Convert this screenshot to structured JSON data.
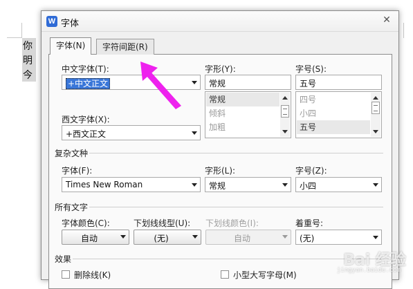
{
  "document": {
    "chars": [
      "你",
      "明",
      "今"
    ]
  },
  "dialog": {
    "app_icon": "W",
    "title": "字体",
    "close_glyph": "✕",
    "tabs": [
      {
        "label": "字体(N)",
        "active": true
      },
      {
        "label": "字符间距(R)",
        "active": false
      }
    ],
    "chinese_font": {
      "label": "中文字体(T):",
      "value": "+中文正文"
    },
    "western_font": {
      "label": "西文字体(X):",
      "value": "+西文正文"
    },
    "style": {
      "label": "字形(Y):",
      "value": "常规",
      "options": [
        "常规",
        "倾斜",
        "加粗"
      ],
      "selected": "常规"
    },
    "size": {
      "label": "字号(S):",
      "value": "五号",
      "options": [
        "四号",
        "小四",
        "五号"
      ],
      "selected": "五号"
    },
    "complex_script": {
      "title": "复杂文种",
      "font_label": "字体(F):",
      "font_value": "Times New Roman",
      "style_label": "字形(L):",
      "style_value": "常规",
      "size_label": "字号(Z):",
      "size_value": "小四"
    },
    "all_text": {
      "title": "所有文字",
      "font_color_label": "字体颜色(C):",
      "font_color_value": "自动",
      "underline_type_label": "下划线线型(U):",
      "underline_type_value": "(无)",
      "underline_color_label": "下划线颜色(I):",
      "underline_color_value": "自动",
      "emphasis_label": "着重号:",
      "emphasis_value": "(无)"
    },
    "effects": {
      "title": "效果",
      "strikethrough_label": "删除线(K)",
      "small_caps_label": "小型大写字母(M)"
    }
  },
  "annotation": {
    "color": "#ee22ee",
    "points_to": "tab-spacing"
  },
  "watermark": {
    "main": "Bai 经验",
    "sub": "jingyan.baidu.com"
  },
  "colors": {
    "accent": "#3a77d9",
    "dialog_bg": "#f0f0f0",
    "arrow": "#ee22ee"
  }
}
